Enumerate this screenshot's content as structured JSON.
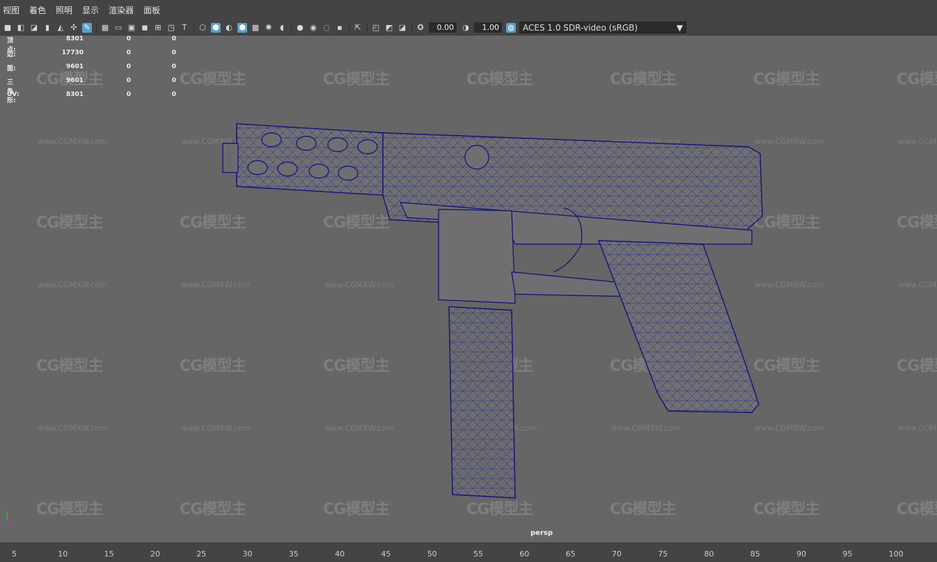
{
  "menu": [
    "视图",
    "着色",
    "照明",
    "显示",
    "渲染器",
    "面板"
  ],
  "toolbar": {
    "icons_left": [
      "camera-icon",
      "camera-film-icon",
      "camera-lock-icon",
      "bookmark-icon",
      "image-plane-icon",
      "camera-attrs-icon",
      "grease-pencil-icon"
    ],
    "icons_mid": [
      "grid-icon",
      "film-gate-icon",
      "resolution-gate-icon",
      "gate-mask-icon",
      "field-chart-icon",
      "safe-action-icon",
      "safe-title-icon"
    ],
    "icons_shading": [
      "wireframe-icon",
      "smooth-shade-icon",
      "bounding-box-icon",
      "textured-icon",
      "default-light-icon",
      "shadows-icon",
      "ambient-occlusion-icon",
      "motion-blur-icon",
      "antialias-icon",
      "depth-of-field-icon"
    ],
    "icons_right": [
      "isolate-select-icon",
      "xray-icon",
      "xray-joints-icon",
      "backface-icon",
      "exposure-icon",
      "gamma-icon"
    ],
    "exposure": "0.00",
    "gamma": "1.00",
    "color_space": "ACES 1.0 SDR-video (sRGB)"
  },
  "hud": [
    {
      "label": "顶点:",
      "v1": "8301",
      "v2": "0",
      "v3": "0"
    },
    {
      "label": "边:",
      "v1": "17730",
      "v2": "0",
      "v3": "0"
    },
    {
      "label": "面:",
      "v1": "9601",
      "v2": "0",
      "v3": "0"
    },
    {
      "label": "三角形:",
      "v1": "9601",
      "v2": "0",
      "v3": "0"
    },
    {
      "label": "UV:",
      "v1": "8301",
      "v2": "0",
      "v3": "0"
    }
  ],
  "watermark": {
    "logo": "CG模型主",
    "url": "www.CGMXW.com"
  },
  "camera": "persp",
  "timeline_ticks": [
    "5",
    "10",
    "15",
    "20",
    "25",
    "30",
    "35",
    "40",
    "45",
    "50",
    "55",
    "60",
    "65",
    "70",
    "75",
    "80",
    "85",
    "90",
    "95",
    "100"
  ],
  "colors": {
    "accent": "#5aa0c8",
    "wire": "#1a1a78",
    "mesh_fill": "#6f6f72"
  }
}
